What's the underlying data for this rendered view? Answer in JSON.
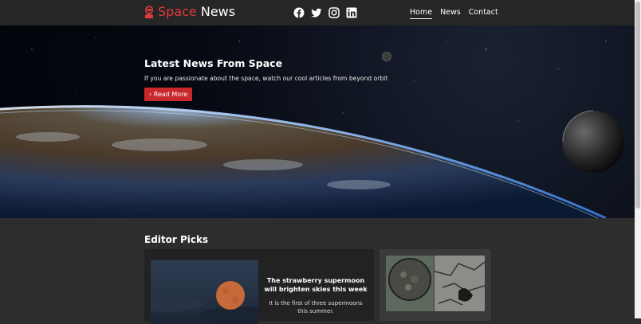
{
  "nav": {
    "brand_part1": "Space",
    "brand_part2": " News",
    "social_icons": [
      "facebook-icon",
      "twitter-icon",
      "instagram-icon",
      "linkedin-icon"
    ],
    "links": [
      "Home",
      "News",
      "Contact"
    ]
  },
  "hero": {
    "title": "Latest News From Space",
    "subtitle": "If you are passionate about the space, watch our cool articles from beyond orbit",
    "button": "Read More"
  },
  "editor_picks": {
    "heading": "Editor Picks",
    "cards": [
      {
        "title": "The strawberry supermoon will brighten skies this week",
        "description": "It is the first of three supermoons this summer."
      }
    ]
  },
  "colors": {
    "accent": "#e0393e",
    "button": "#c8282c",
    "background": "#2d2d2d",
    "navbar": "#262626"
  }
}
